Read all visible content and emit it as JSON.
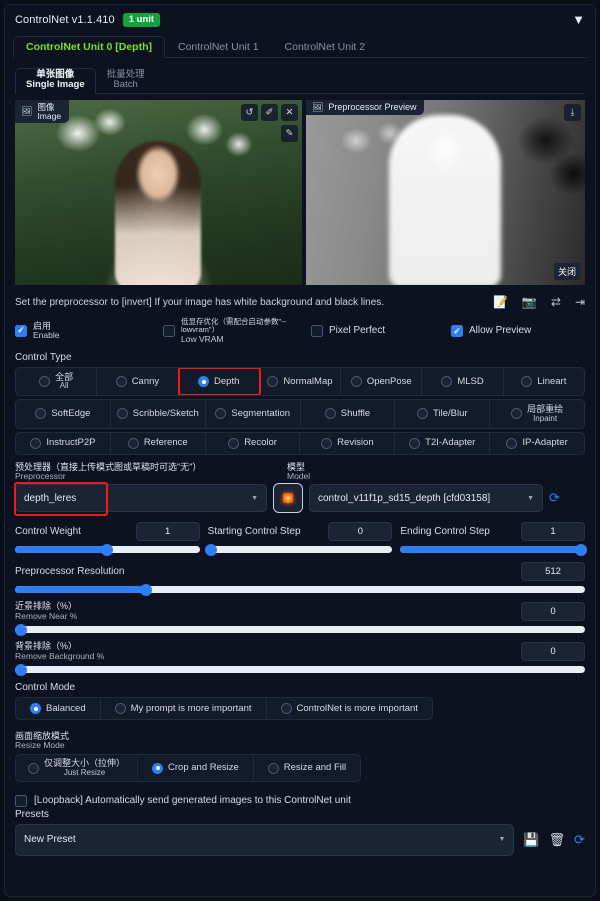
{
  "header": {
    "title": "ControlNet v1.1.410",
    "unit_badge": "1 unit",
    "collapse_icon": "▼"
  },
  "unit_tabs": [
    {
      "label": "ControlNet Unit 0 [Depth]",
      "active": true
    },
    {
      "label": "ControlNet Unit 1",
      "active": false
    },
    {
      "label": "ControlNet Unit 2",
      "active": false
    }
  ],
  "source_tabs": [
    {
      "cn": "单张图像",
      "en": "Single Image",
      "active": true
    },
    {
      "cn": "批量处理",
      "en": "Batch",
      "active": false
    }
  ],
  "image_panel": {
    "input_tag_cn": "图像",
    "input_tag_en": "Image",
    "input_tag_icon": "image-icon",
    "ctrl_undo": "↺",
    "ctrl_erase": "✐",
    "ctrl_close": "✕",
    "ctrl_edit": "✎",
    "preview_tag": "Preprocessor Preview",
    "preview_tag_icon": "picture-icon",
    "preview_download": "⤓",
    "preview_close_cn": "关闭"
  },
  "hint": {
    "text": "Set the preprocessor to [invert] If your image has white background and black lines.",
    "icons": [
      "note-icon",
      "camera-icon",
      "swap-icon",
      "send-icon"
    ]
  },
  "checkboxes": [
    {
      "cn": "启用",
      "en": "Enable",
      "checked": true
    },
    {
      "cn": "低显存优化（需配合启动参数\"--lowvram\"）",
      "en": "Low VRAM",
      "checked": false
    },
    {
      "cn": "",
      "en": "Pixel Perfect",
      "checked": false
    },
    {
      "cn": "",
      "en": "Allow Preview",
      "checked": true
    }
  ],
  "control_type": {
    "label": "Control Type",
    "rows": [
      [
        {
          "cn": "全部",
          "en": "All",
          "selected": false
        },
        {
          "cn": "",
          "en": "Canny",
          "selected": false
        },
        {
          "cn": "",
          "en": "Depth",
          "selected": true,
          "highlight": true
        },
        {
          "cn": "",
          "en": "NormalMap",
          "selected": false
        },
        {
          "cn": "",
          "en": "OpenPose",
          "selected": false
        },
        {
          "cn": "",
          "en": "MLSD",
          "selected": false
        },
        {
          "cn": "",
          "en": "Lineart",
          "selected": false
        }
      ],
      [
        {
          "cn": "",
          "en": "SoftEdge",
          "selected": false
        },
        {
          "cn": "",
          "en": "Scribble/Sketch",
          "selected": false
        },
        {
          "cn": "",
          "en": "Segmentation",
          "selected": false
        },
        {
          "cn": "",
          "en": "Shuffle",
          "selected": false
        },
        {
          "cn": "",
          "en": "Tile/Blur",
          "selected": false
        },
        {
          "cn": "局部重绘",
          "en": "Inpaint",
          "selected": false
        }
      ],
      [
        {
          "cn": "",
          "en": "InstructP2P",
          "selected": false
        },
        {
          "cn": "",
          "en": "Reference",
          "selected": false
        },
        {
          "cn": "",
          "en": "Recolor",
          "selected": false
        },
        {
          "cn": "",
          "en": "Revision",
          "selected": false
        },
        {
          "cn": "",
          "en": "T2I-Adapter",
          "selected": false
        },
        {
          "cn": "",
          "en": "IP-Adapter",
          "selected": false
        }
      ]
    ]
  },
  "preprocessor": {
    "label_cn": "预处理器（直接上传模式图或草稿时可选\"无\"）",
    "label_en": "Preprocessor",
    "value": "depth_leres",
    "caret": "▼",
    "run_button": "explosion-icon"
  },
  "model": {
    "label_cn": "模型",
    "label_en": "Model",
    "value": "control_v11f1p_sd15_depth [cfd03158]",
    "caret": "▼",
    "refresh": "⟳"
  },
  "sliders": {
    "control_weight": {
      "label": "Control Weight",
      "value": "1",
      "percent": 50
    },
    "starting_step": {
      "label": "Starting Control Step",
      "value": "0",
      "percent": 0
    },
    "ending_step": {
      "label": "Ending Control Step",
      "value": "1",
      "percent": 100
    },
    "preproc_resolution": {
      "label": "Preprocessor Resolution",
      "value": "512",
      "percent": 23
    },
    "remove_near": {
      "cn": "近景排除（%）",
      "en": "Remove Near %",
      "value": "0",
      "percent": 0
    },
    "remove_background": {
      "cn": "背景排除（%）",
      "en": "Remove Background %",
      "value": "0",
      "percent": 0
    }
  },
  "control_mode": {
    "label": "Control Mode",
    "options": [
      {
        "label": "Balanced",
        "selected": true
      },
      {
        "label": "My prompt is more important",
        "selected": false
      },
      {
        "label": "ControlNet is more important",
        "selected": false
      }
    ]
  },
  "resize_mode": {
    "label_cn": "画面缩放模式",
    "label_en": "Resize Mode",
    "options": [
      {
        "cn": "仅调整大小（拉伸）",
        "en": "Just Resize",
        "selected": false
      },
      {
        "cn": "",
        "en": "Crop and Resize",
        "selected": true
      },
      {
        "cn": "",
        "en": "Resize and Fill",
        "selected": false
      }
    ]
  },
  "loopback": {
    "label": "[Loopback] Automatically send generated images to this ControlNet unit",
    "checked": false
  },
  "presets": {
    "label": "Presets",
    "value": "New Preset",
    "caret": "▼",
    "save_icon": "💾",
    "delete_icon": "🗑",
    "refresh_icon": "⟳"
  },
  "colors": {
    "accent_blue": "#2e7ef5",
    "accent_green": "#7ce01a",
    "badge_green": "#12a33c",
    "highlight_red": "#ee1c16",
    "background": "#0b0f19"
  }
}
